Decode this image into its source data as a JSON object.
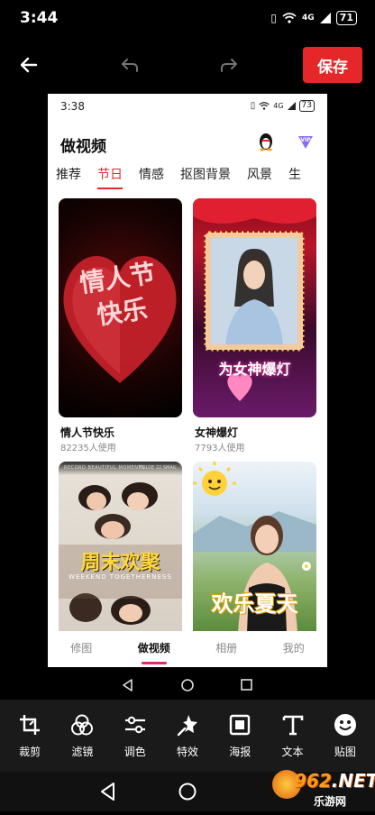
{
  "status_bar": {
    "time": "3:44",
    "battery": "71",
    "signal": "4G"
  },
  "editor": {
    "save_label": "保存"
  },
  "preview": {
    "status_time": "3:38",
    "battery": "73",
    "signal": "4G",
    "title": "做视频",
    "vip_label": "VIP",
    "tabs": [
      {
        "label": "推荐"
      },
      {
        "label": "节日",
        "active": true
      },
      {
        "label": "情感"
      },
      {
        "label": "抠图背景"
      },
      {
        "label": "风景"
      },
      {
        "label": "生"
      }
    ],
    "cards": [
      {
        "art": "情人节\n快乐",
        "title": "情人节快乐",
        "uses": "82235人使用"
      },
      {
        "art": "为女神爆灯",
        "title": "女神爆灯",
        "uses": "7793人使用"
      },
      {
        "art": "周末欢聚",
        "banner": "RECORD BEAUTIFUL MOMENTS",
        "banner2": "HOLDE 22 SMAIL",
        "subart": "WEEKEND TOGETHERNESS"
      },
      {
        "art": "欢乐夏天"
      }
    ],
    "bottom_nav": [
      {
        "label": "修图"
      },
      {
        "label": "做视频",
        "active": true
      },
      {
        "label": "相册"
      },
      {
        "label": "我的"
      }
    ]
  },
  "tools": [
    {
      "label": "裁剪",
      "icon": "crop-icon"
    },
    {
      "label": "滤镜",
      "icon": "filter-icon"
    },
    {
      "label": "调色",
      "icon": "adjust-icon"
    },
    {
      "label": "特效",
      "icon": "effects-icon"
    },
    {
      "label": "海报",
      "icon": "poster-icon"
    },
    {
      "label": "文本",
      "icon": "text-icon"
    },
    {
      "label": "贴图",
      "icon": "sticker-icon"
    }
  ],
  "watermark": {
    "brand": "962",
    "tld": ".NET",
    "sub": "乐游网"
  },
  "colors": {
    "accent": "#e6272a",
    "nav_active": "#e0286a",
    "toolbar_bg": "#1a1a1a"
  }
}
